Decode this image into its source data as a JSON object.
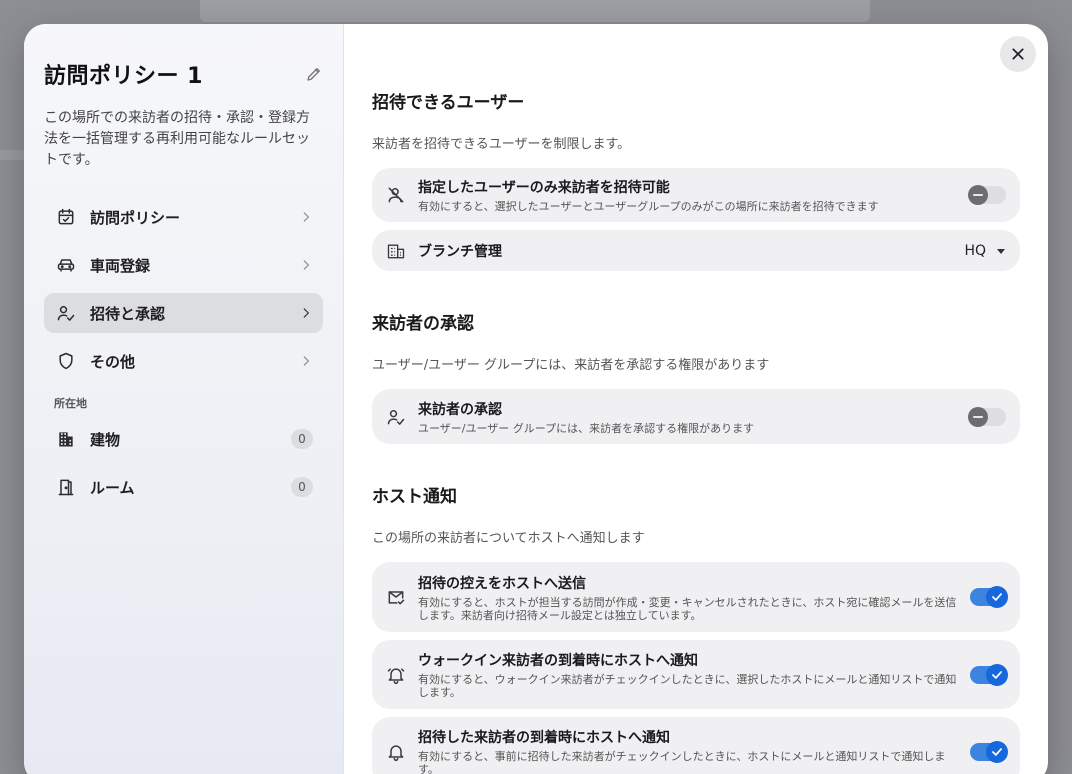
{
  "colors": {
    "accent": "#1668dc",
    "toggle_track_on": "#3d84e0",
    "active_nav": "#dcdde1"
  },
  "sidebar": {
    "title": "訪問ポリシー 1",
    "description": "この場所での来訪者の招待・承認・登録方法を一括管理する再利用可能なルールセットです。",
    "items": [
      {
        "label": "訪問ポリシー",
        "icon": "calendar-check-icon"
      },
      {
        "label": "車両登録",
        "icon": "car-icon"
      },
      {
        "label": "招待と承認",
        "icon": "user-check-icon",
        "active": true
      },
      {
        "label": "その他",
        "icon": "shield-icon"
      }
    ],
    "location_label": "所在地",
    "locations": [
      {
        "label": "建物",
        "count": "0",
        "icon": "building-icon"
      },
      {
        "label": "ルーム",
        "count": "0",
        "icon": "door-icon"
      }
    ]
  },
  "main": {
    "sections": {
      "invite": {
        "title": "招待できるユーザー",
        "subtitle": "来訪者を招待できるユーザーを制限します。",
        "restrict": {
          "title": "指定したユーザーのみ来訪者を招待可能",
          "desc": "有効にすると、選択したユーザーとユーザーグループのみがこの場所に来訪者を招待できます",
          "enabled": false
        },
        "branch": {
          "title": "ブランチ管理",
          "value": "HQ"
        }
      },
      "approval": {
        "title": "来訪者の承認",
        "subtitle": "ユーザー/ユーザー グループには、来訪者を承認する権限があります",
        "item": {
          "title": "来訪者の承認",
          "desc": "ユーザー/ユーザー グループには、来訪者を承認する権限があります",
          "enabled": false
        }
      },
      "host": {
        "title": "ホスト通知",
        "subtitle": "この場所の来訪者についてホストへ通知します",
        "items": [
          {
            "title": "招待の控えをホストへ送信",
            "desc": "有効にすると、ホストが担当する訪問が作成・変更・キャンセルされたときに、ホスト宛に確認メールを送信します。来訪者向け招待メール設定とは独立しています。",
            "enabled": true
          },
          {
            "title": "ウォークイン来訪者の到着時にホストへ通知",
            "desc": "有効にすると、ウォークイン来訪者がチェックインしたときに、選択したホストにメールと通知リストで通知します。",
            "enabled": true
          },
          {
            "title": "招待した来訪者の到着時にホストへ通知",
            "desc": "有効にすると、事前に招待した来訪者がチェックインしたときに、ホストにメールと通知リストで通知します。",
            "enabled": true
          }
        ]
      }
    }
  }
}
